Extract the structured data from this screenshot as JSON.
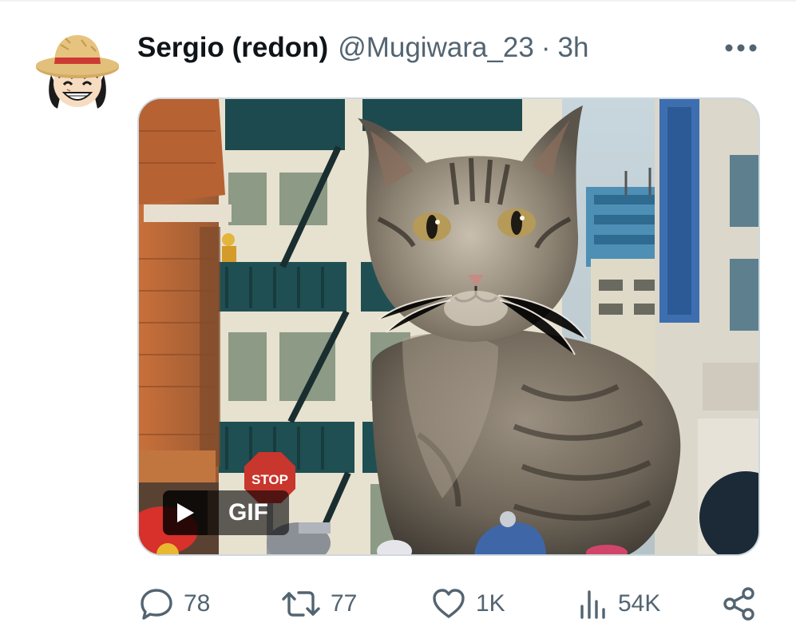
{
  "tweet": {
    "author": {
      "display_name": "Sergio (redon)",
      "handle": "@Mugiwara_23",
      "avatar_icon": "straw-hat-character-avatar"
    },
    "separator": "·",
    "time": "3h",
    "more_icon": "more-horizontal-icon",
    "media": {
      "type": "gif",
      "badge_label": "GIF",
      "play_icon": "play-icon",
      "sign_text": "STOP"
    },
    "actions": {
      "reply": {
        "icon": "reply-bubble-icon",
        "count": "78"
      },
      "retweet": {
        "icon": "retweet-icon",
        "count": "77"
      },
      "like": {
        "icon": "heart-icon",
        "count": "1K"
      },
      "views": {
        "icon": "views-chart-icon",
        "count": "54K"
      },
      "share": {
        "icon": "share-icon"
      }
    },
    "colors": {
      "text_primary": "#0f1419",
      "text_secondary": "#536471",
      "media_border": "#cfd9de"
    }
  }
}
